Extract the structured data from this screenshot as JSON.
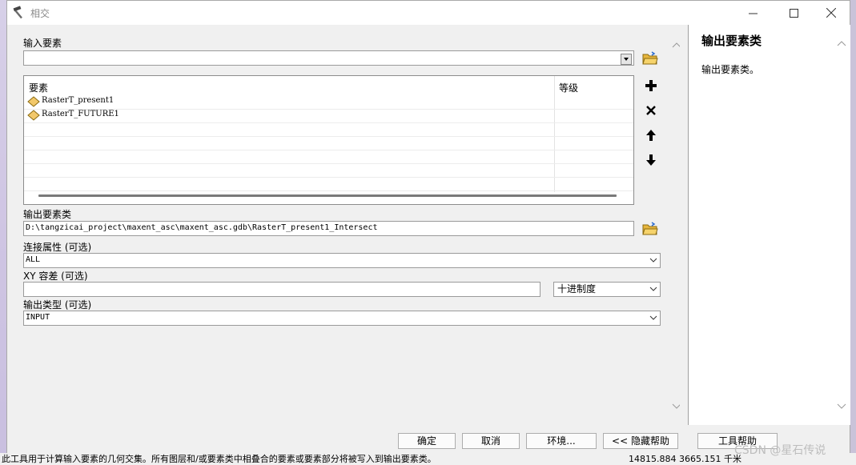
{
  "background": {
    "status_text": "此工具用于计算输入要素的几何交集。所有图层和/或要素类中相叠合的要素或要素部分将被写入到输出要素类。",
    "coords": "14815.884  3665.151 千米"
  },
  "window": {
    "title": "相交",
    "icon": "hammer-icon"
  },
  "input_features": {
    "label": "输入要素",
    "value": ""
  },
  "feature_table": {
    "headers": [
      "要素",
      "等级"
    ],
    "rows": [
      {
        "name": "RasterT_present1",
        "rank": ""
      },
      {
        "name": "RasterT_FUTURE1",
        "rank": ""
      },
      {
        "name": "",
        "rank": ""
      },
      {
        "name": "",
        "rank": ""
      },
      {
        "name": "",
        "rank": ""
      },
      {
        "name": "",
        "rank": ""
      },
      {
        "name": "",
        "rank": ""
      }
    ]
  },
  "output_fc": {
    "label": "输出要素类",
    "value": "D:\\tangzicai_project\\maxent_asc\\maxent_asc.gdb\\RasterT_present1_Intersect"
  },
  "join_attributes": {
    "label": "连接属性 (可选)",
    "value": "ALL"
  },
  "xy_tolerance": {
    "label": "XY 容差 (可选)",
    "value": "",
    "unit": "十进制度"
  },
  "output_type": {
    "label": "输出类型 (可选)",
    "value": "INPUT"
  },
  "help": {
    "title": "输出要素类",
    "body": "输出要素类。"
  },
  "buttons": {
    "ok": "确定",
    "cancel": "取消",
    "environments": "环境...",
    "hide_help": "<< 隐藏帮助",
    "tool_help": "工具帮助"
  },
  "watermark": "CSDN @星石传说"
}
